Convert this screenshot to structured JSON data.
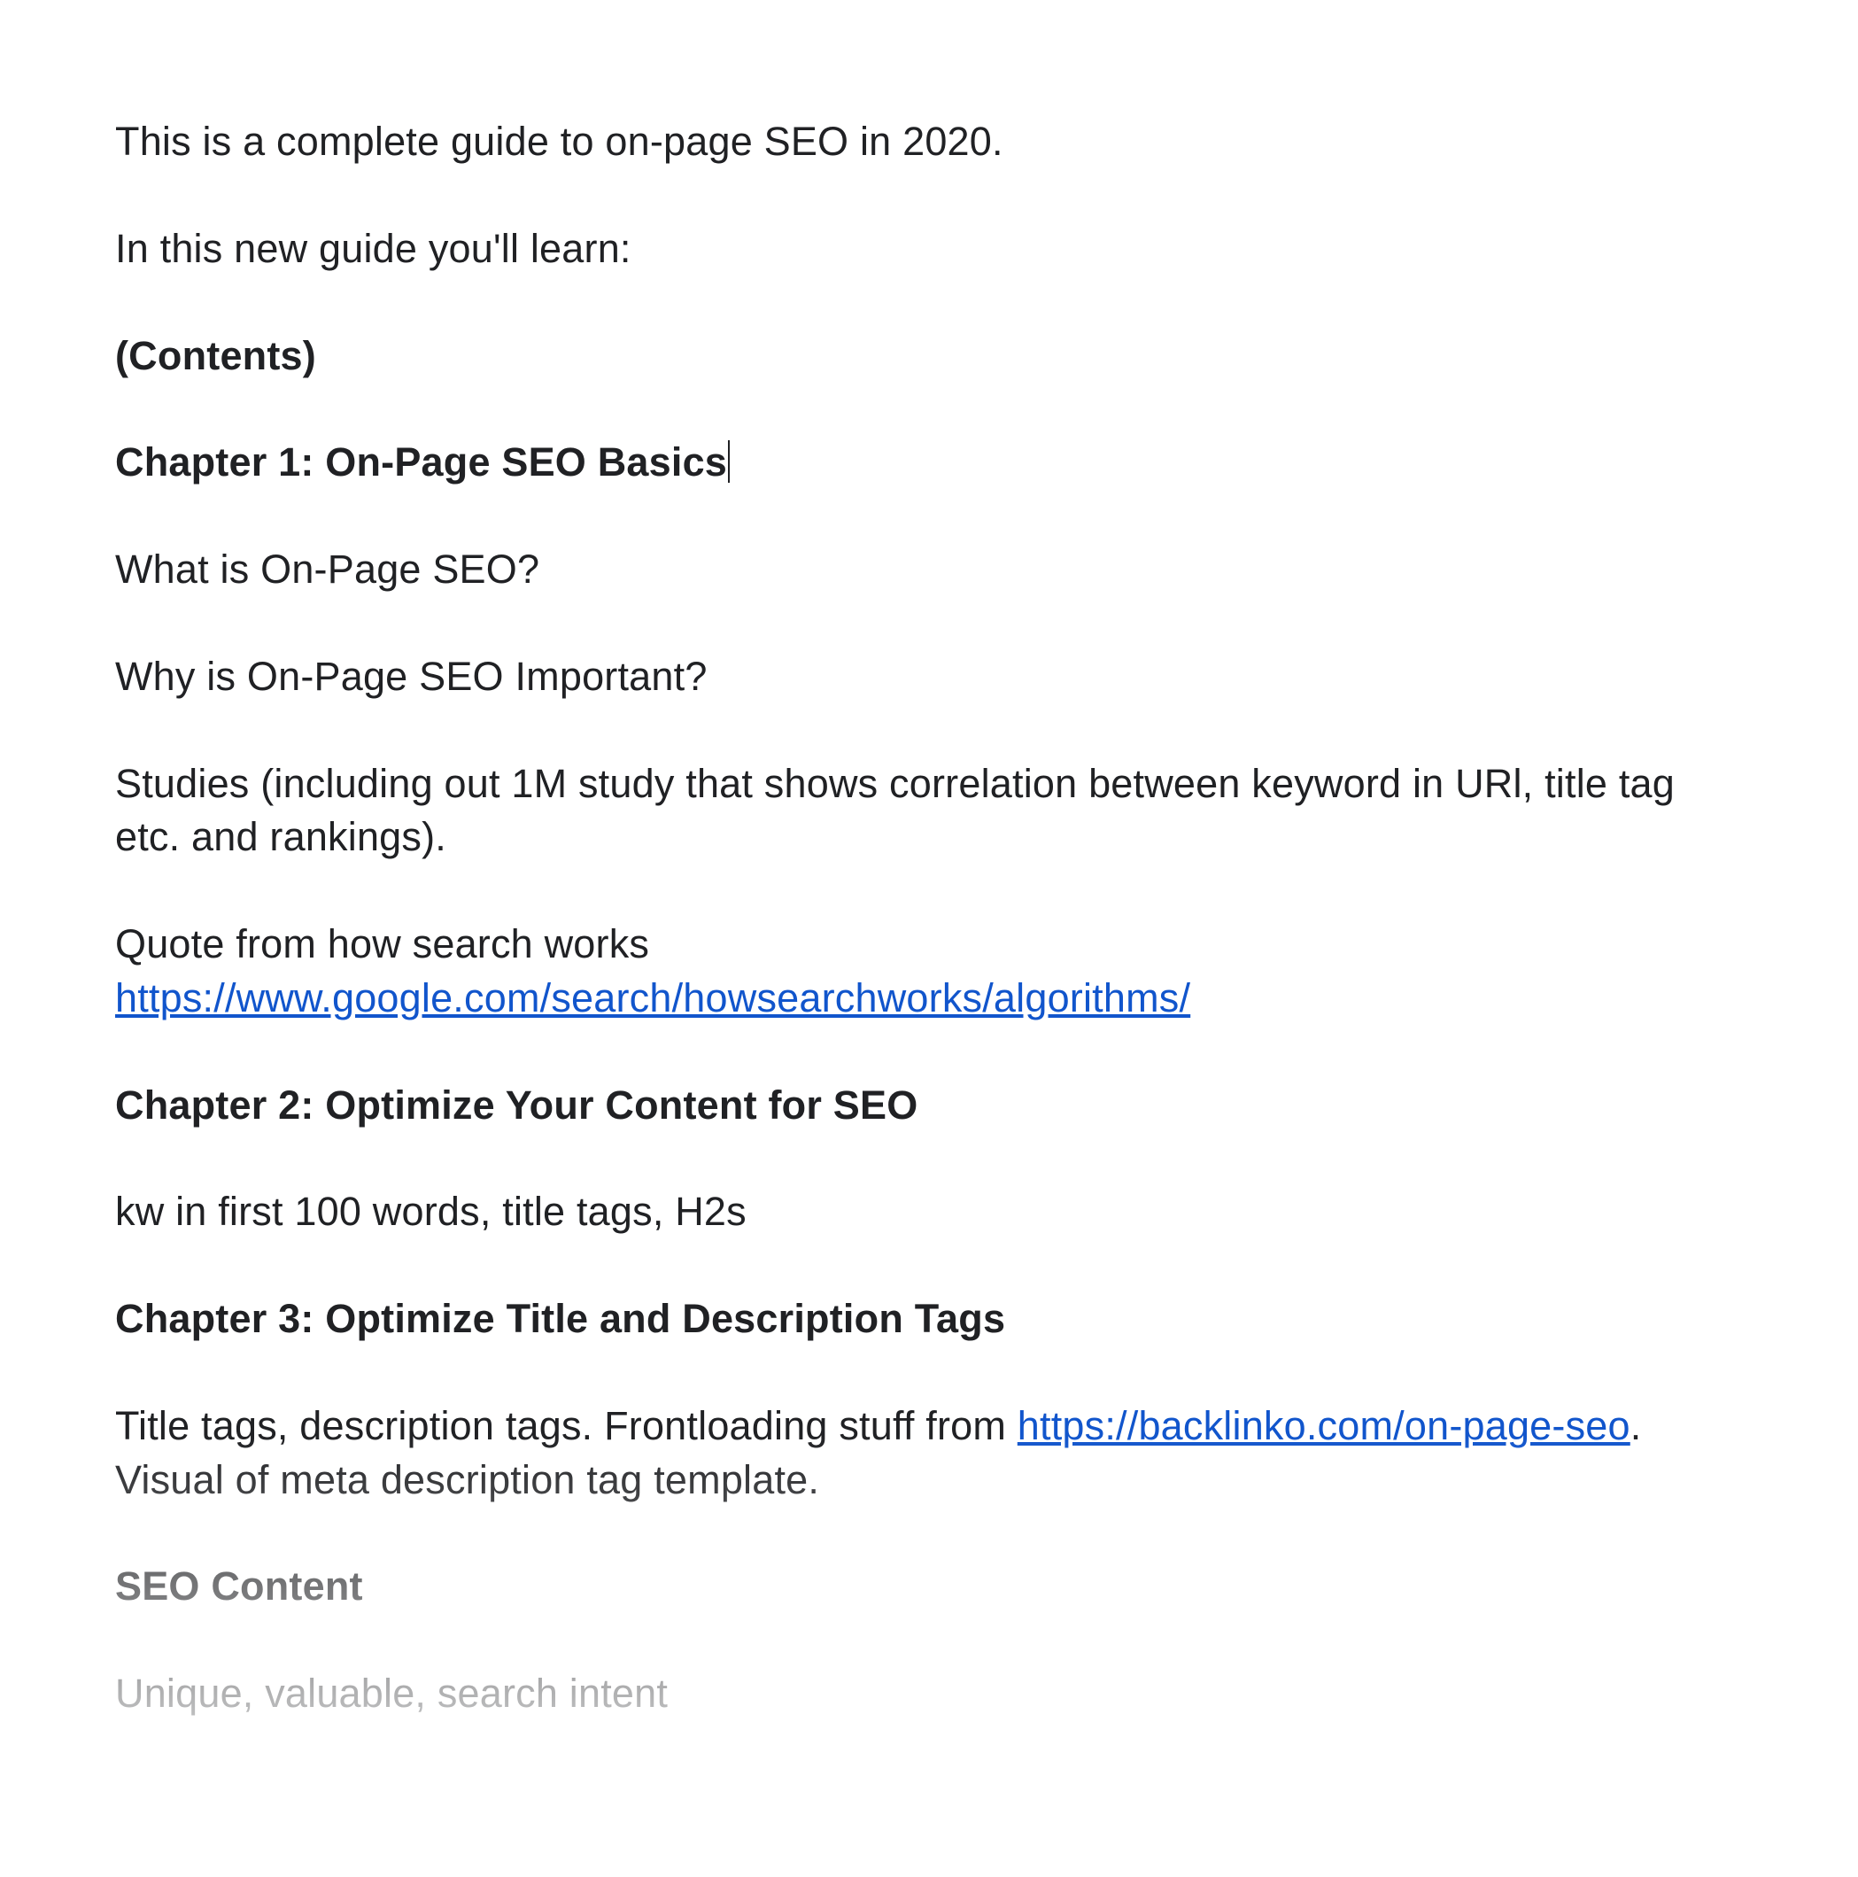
{
  "intro1": "This is a complete guide to on-page SEO in 2020.",
  "intro2": "In this new guide you'll learn:",
  "contentsLabel": "(Contents)",
  "ch1": {
    "title": "Chapter 1: On-Page SEO Basics",
    "q1": "What is On-Page SEO?",
    "q2": "Why is On-Page SEO Important?",
    "studies": "Studies (including out 1M study that shows correlation between keyword in URl, title tag etc. and rankings).",
    "quoteLead": "Quote from how search works",
    "quoteLink": "https://www.google.com/search/howsearchworks/algorithms/"
  },
  "ch2": {
    "title": "Chapter 2: Optimize Your Content for SEO",
    "body": "kw in first 100 words, title tags, H2s"
  },
  "ch3": {
    "title": "Chapter 3: Optimize Title and Description Tags",
    "bodyPre": "Title tags, description tags. Frontloading stuff from ",
    "link": "https://backlinko.com/on-page-seo",
    "bodyPost": ". Visual of meta description tag template."
  },
  "seoContent": {
    "heading": "SEO Content",
    "body": "Unique, valuable, search intent"
  }
}
